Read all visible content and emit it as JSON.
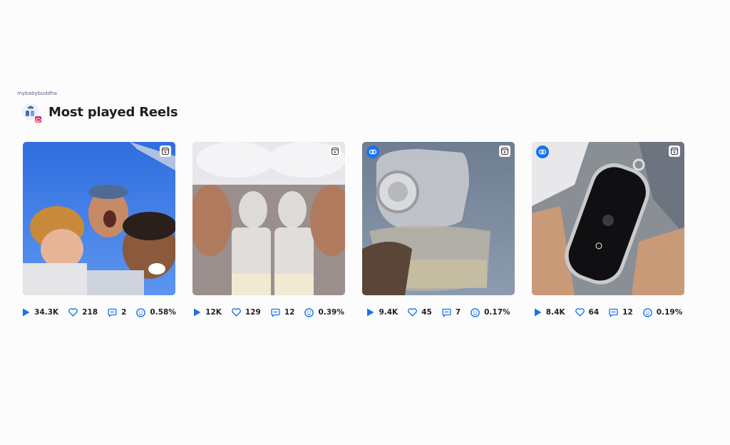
{
  "account": {
    "handle": "mybabybuddha"
  },
  "header": {
    "title": "Most played Reels"
  },
  "colors": {
    "accent": "#1a73e8",
    "text": "#1e1e26"
  },
  "reels": [
    {
      "plays": "34.3K",
      "likes": "218",
      "comments": "2",
      "engagement": "0.58%",
      "collab": false,
      "badge_icon": "reel-icon"
    },
    {
      "plays": "12K",
      "likes": "129",
      "comments": "12",
      "engagement": "0.39%",
      "collab": false,
      "badge_icon": "reel-icon"
    },
    {
      "plays": "9.4K",
      "likes": "45",
      "comments": "7",
      "engagement": "0.17%",
      "collab": true,
      "badge_icon": "reel-icon"
    },
    {
      "plays": "8.4K",
      "likes": "64",
      "comments": "12",
      "engagement": "0.19%",
      "collab": true,
      "badge_icon": "reel-icon"
    }
  ]
}
